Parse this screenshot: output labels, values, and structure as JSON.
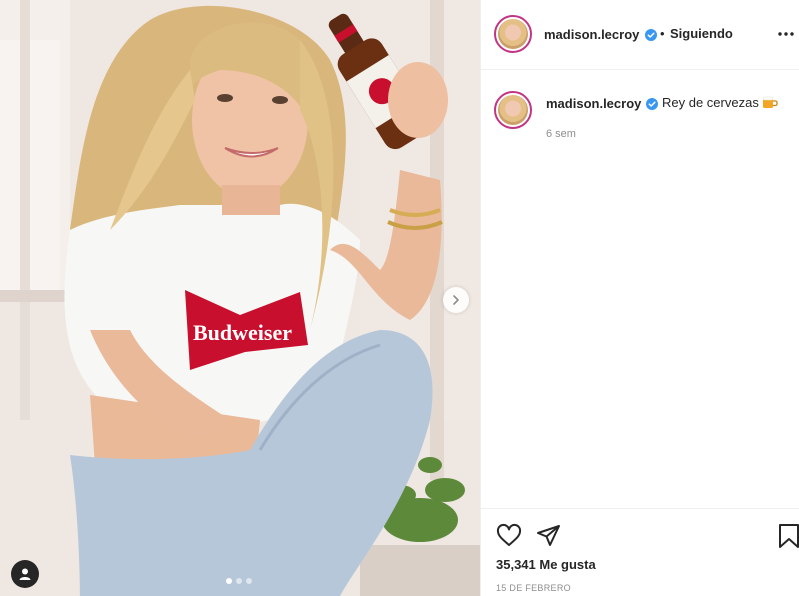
{
  "post": {
    "image_alt": "Mujer rubia con camiseta blanca Budweiser sosteniendo una botella",
    "shirt_text": "Budweiser",
    "carousel": {
      "total_slides": 3,
      "active_index": 0
    }
  },
  "header": {
    "username": "madison.lecroy",
    "separator": "•",
    "follow_label": "Siguiendo",
    "verified": true
  },
  "caption": {
    "username": "madison.lecroy",
    "text": "Rey de cervezas",
    "emoji": "beer-mug-icon",
    "time_ago": "6 sem"
  },
  "footer": {
    "likes_label": "35,341 Me gusta",
    "date": "15 DE FEBRERO"
  },
  "colors": {
    "story_ring": "#c13584",
    "verified_blue": "#3897f0",
    "text_primary": "#262626",
    "text_secondary": "#8e8e8e",
    "border": "#efefef",
    "budweiser_red": "#c8102e"
  }
}
